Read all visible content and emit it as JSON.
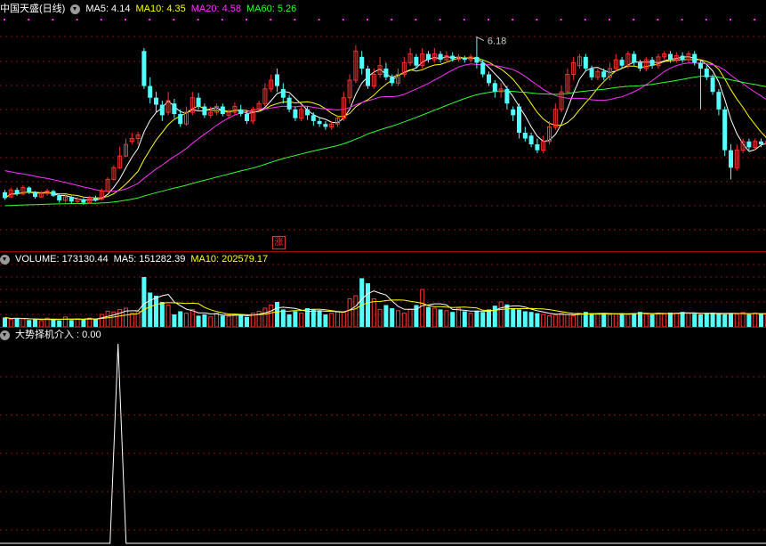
{
  "price_panel": {
    "stock_name": "中国天盛(日线)",
    "ma5": "MA5: 4.14",
    "ma10": "MA10: 4.35",
    "ma20": "MA20: 4.58",
    "ma60": "MA60: 5.26",
    "high_marker": "6.18",
    "limit_up_marker": "涨"
  },
  "volume_panel": {
    "volume": "VOLUME: 173130.44",
    "ma5": "MA5: 151282.39",
    "ma10": "MA10: 202579.17"
  },
  "indicator_panel": {
    "label": "大势择机介入 : 0.00"
  },
  "colors": {
    "up": "#ff3232",
    "down": "#54ffff",
    "ma5": "#ffffff",
    "ma10": "#ffff00",
    "ma20": "#ff32ff",
    "ma60": "#32ff32",
    "grid": "#8a1010",
    "dots": "#ff32ff"
  },
  "chart_data": [
    {
      "type": "candlestick",
      "title": "中国天盛(日线)",
      "ylim": [
        2.6,
        6.6
      ],
      "highest_label": 6.18,
      "moving_averages": {
        "MA5": 4.14,
        "MA10": 4.35,
        "MA20": 4.58,
        "MA60": 5.26
      },
      "candles": [
        {
          "o": 3.58,
          "c": 3.48,
          "h": 3.62,
          "l": 3.45
        },
        {
          "o": 3.5,
          "c": 3.62,
          "h": 3.66,
          "l": 3.48
        },
        {
          "o": 3.62,
          "c": 3.55,
          "h": 3.66,
          "l": 3.52
        },
        {
          "o": 3.55,
          "c": 3.66,
          "h": 3.7,
          "l": 3.53
        },
        {
          "o": 3.66,
          "c": 3.58,
          "h": 3.68,
          "l": 3.55
        },
        {
          "o": 3.58,
          "c": 3.5,
          "h": 3.6,
          "l": 3.47
        },
        {
          "o": 3.5,
          "c": 3.56,
          "h": 3.6,
          "l": 3.48
        },
        {
          "o": 3.56,
          "c": 3.6,
          "h": 3.64,
          "l": 3.52
        },
        {
          "o": 3.6,
          "c": 3.52,
          "h": 3.62,
          "l": 3.5
        },
        {
          "o": 3.52,
          "c": 3.44,
          "h": 3.56,
          "l": 3.4
        },
        {
          "o": 3.44,
          "c": 3.5,
          "h": 3.54,
          "l": 3.4
        },
        {
          "o": 3.5,
          "c": 3.42,
          "h": 3.52,
          "l": 3.38
        },
        {
          "o": 3.42,
          "c": 3.46,
          "h": 3.5,
          "l": 3.38
        },
        {
          "o": 3.46,
          "c": 3.4,
          "h": 3.48,
          "l": 3.36
        },
        {
          "o": 3.4,
          "c": 3.48,
          "h": 3.52,
          "l": 3.38
        },
        {
          "o": 3.48,
          "c": 3.44,
          "h": 3.52,
          "l": 3.42
        },
        {
          "o": 3.46,
          "c": 3.6,
          "h": 3.64,
          "l": 3.44
        },
        {
          "o": 3.6,
          "c": 3.8,
          "h": 3.84,
          "l": 3.58
        },
        {
          "o": 3.8,
          "c": 4.0,
          "h": 4.04,
          "l": 3.78
        },
        {
          "o": 4.0,
          "c": 4.2,
          "h": 4.36,
          "l": 3.98
        },
        {
          "o": 4.2,
          "c": 4.4,
          "h": 4.5,
          "l": 4.18
        },
        {
          "o": 4.45,
          "c": 4.5,
          "h": 4.6,
          "l": 4.4
        },
        {
          "o": 4.5,
          "c": 4.56,
          "h": 4.62,
          "l": 4.4
        },
        {
          "o": 6.0,
          "c": 5.4,
          "h": 6.05,
          "l": 5.35
        },
        {
          "o": 5.4,
          "c": 5.2,
          "h": 5.55,
          "l": 5.1
        },
        {
          "o": 5.2,
          "c": 5.08,
          "h": 5.3,
          "l": 4.95
        },
        {
          "o": 5.08,
          "c": 4.9,
          "h": 5.15,
          "l": 4.8
        },
        {
          "o": 4.95,
          "c": 5.15,
          "h": 5.3,
          "l": 4.9
        },
        {
          "o": 5.1,
          "c": 4.92,
          "h": 5.18,
          "l": 4.85
        },
        {
          "o": 4.92,
          "c": 4.75,
          "h": 5.0,
          "l": 4.7
        },
        {
          "o": 4.75,
          "c": 4.95,
          "h": 5.05,
          "l": 4.72
        },
        {
          "o": 4.95,
          "c": 5.2,
          "h": 5.3,
          "l": 4.9
        },
        {
          "o": 5.2,
          "c": 5.05,
          "h": 5.28,
          "l": 5.0
        },
        {
          "o": 5.05,
          "c": 4.9,
          "h": 5.1,
          "l": 4.85
        },
        {
          "o": 4.9,
          "c": 4.95,
          "h": 5.05,
          "l": 4.85
        },
        {
          "o": 4.95,
          "c": 5.05,
          "h": 5.1,
          "l": 4.9
        },
        {
          "o": 5.05,
          "c": 4.92,
          "h": 5.1,
          "l": 4.88
        },
        {
          "o": 4.9,
          "c": 4.95,
          "h": 5.0,
          "l": 4.85
        },
        {
          "o": 4.95,
          "c": 5.05,
          "h": 5.12,
          "l": 4.9
        },
        {
          "o": 5.0,
          "c": 4.92,
          "h": 5.08,
          "l": 4.88
        },
        {
          "o": 4.92,
          "c": 4.8,
          "h": 4.98,
          "l": 4.75
        },
        {
          "o": 4.8,
          "c": 5.0,
          "h": 5.05,
          "l": 4.75
        },
        {
          "o": 5.0,
          "c": 5.1,
          "h": 5.15,
          "l": 4.95
        },
        {
          "o": 5.1,
          "c": 5.35,
          "h": 5.45,
          "l": 5.05
        },
        {
          "o": 5.35,
          "c": 5.5,
          "h": 5.6,
          "l": 5.3
        },
        {
          "o": 5.6,
          "c": 5.4,
          "h": 5.7,
          "l": 5.3
        },
        {
          "o": 5.35,
          "c": 5.2,
          "h": 5.45,
          "l": 5.1
        },
        {
          "o": 5.2,
          "c": 5.0,
          "h": 5.25,
          "l": 4.95
        },
        {
          "o": 5.0,
          "c": 4.85,
          "h": 5.05,
          "l": 4.8
        },
        {
          "o": 4.85,
          "c": 5.0,
          "h": 5.05,
          "l": 4.8
        },
        {
          "o": 5.0,
          "c": 4.9,
          "h": 5.05,
          "l": 4.82
        },
        {
          "o": 4.9,
          "c": 4.8,
          "h": 4.95,
          "l": 4.72
        },
        {
          "o": 4.8,
          "c": 4.75,
          "h": 4.85,
          "l": 4.7
        },
        {
          "o": 4.75,
          "c": 4.7,
          "h": 4.8,
          "l": 4.65
        },
        {
          "o": 4.7,
          "c": 4.75,
          "h": 4.8,
          "l": 4.65
        },
        {
          "o": 4.75,
          "c": 4.85,
          "h": 4.9,
          "l": 4.7
        },
        {
          "o": 4.85,
          "c": 5.2,
          "h": 5.3,
          "l": 4.8
        },
        {
          "o": 5.2,
          "c": 5.5,
          "h": 5.6,
          "l": 5.1
        },
        {
          "o": 5.5,
          "c": 6.0,
          "h": 6.1,
          "l": 5.45
        },
        {
          "o": 5.9,
          "c": 5.7,
          "h": 6.0,
          "l": 5.6
        },
        {
          "o": 5.7,
          "c": 5.4,
          "h": 5.75,
          "l": 5.35
        },
        {
          "o": 5.4,
          "c": 5.6,
          "h": 5.7,
          "l": 5.35
        },
        {
          "o": 5.6,
          "c": 5.75,
          "h": 5.9,
          "l": 5.55
        },
        {
          "o": 5.7,
          "c": 5.55,
          "h": 5.8,
          "l": 5.5
        },
        {
          "o": 5.55,
          "c": 5.45,
          "h": 5.6,
          "l": 5.4
        },
        {
          "o": 5.45,
          "c": 5.6,
          "h": 5.7,
          "l": 5.4
        },
        {
          "o": 5.6,
          "c": 5.8,
          "h": 5.9,
          "l": 5.55
        },
        {
          "o": 5.8,
          "c": 5.95,
          "h": 6.05,
          "l": 5.75
        },
        {
          "o": 5.9,
          "c": 5.75,
          "h": 5.95,
          "l": 5.7
        },
        {
          "o": 5.75,
          "c": 5.95,
          "h": 6.05,
          "l": 5.7
        },
        {
          "o": 5.95,
          "c": 5.85,
          "h": 6.0,
          "l": 5.8
        },
        {
          "o": 5.85,
          "c": 5.95,
          "h": 6.05,
          "l": 5.8
        },
        {
          "o": 5.95,
          "c": 5.85,
          "h": 6.0,
          "l": 5.8
        },
        {
          "o": 5.85,
          "c": 5.92,
          "h": 6.0,
          "l": 5.8
        },
        {
          "o": 5.92,
          "c": 5.86,
          "h": 5.98,
          "l": 5.82
        },
        {
          "o": 5.86,
          "c": 5.9,
          "h": 5.95,
          "l": 5.82
        },
        {
          "o": 5.88,
          "c": 5.85,
          "h": 5.92,
          "l": 5.8
        },
        {
          "o": 5.85,
          "c": 5.9,
          "h": 5.95,
          "l": 5.8
        },
        {
          "o": 5.9,
          "c": 5.8,
          "h": 6.18,
          "l": 5.7
        },
        {
          "o": 5.8,
          "c": 5.6,
          "h": 5.85,
          "l": 5.55
        },
        {
          "o": 5.6,
          "c": 5.45,
          "h": 5.65,
          "l": 5.4
        },
        {
          "o": 5.45,
          "c": 5.3,
          "h": 5.5,
          "l": 5.2
        },
        {
          "o": 5.3,
          "c": 5.35,
          "h": 5.45,
          "l": 5.2
        },
        {
          "o": 5.35,
          "c": 5.1,
          "h": 5.4,
          "l": 5.0
        },
        {
          "o": 5.0,
          "c": 4.9,
          "h": 5.05,
          "l": 4.8
        },
        {
          "o": 5.05,
          "c": 4.6,
          "h": 5.1,
          "l": 4.5
        },
        {
          "o": 4.6,
          "c": 4.5,
          "h": 4.7,
          "l": 4.45
        },
        {
          "o": 4.55,
          "c": 4.4,
          "h": 4.6,
          "l": 4.35
        },
        {
          "o": 4.4,
          "c": 4.3,
          "h": 4.5,
          "l": 4.25
        },
        {
          "o": 4.3,
          "c": 4.45,
          "h": 4.55,
          "l": 4.25
        },
        {
          "o": 4.45,
          "c": 4.7,
          "h": 4.8,
          "l": 4.4
        },
        {
          "o": 4.7,
          "c": 5.0,
          "h": 5.1,
          "l": 4.65
        },
        {
          "o": 5.0,
          "c": 5.3,
          "h": 5.4,
          "l": 4.95
        },
        {
          "o": 5.3,
          "c": 5.6,
          "h": 5.7,
          "l": 5.25
        },
        {
          "o": 5.6,
          "c": 5.8,
          "h": 5.9,
          "l": 5.5
        },
        {
          "o": 5.75,
          "c": 5.9,
          "h": 5.95,
          "l": 5.7
        },
        {
          "o": 5.9,
          "c": 5.7,
          "h": 5.95,
          "l": 5.65
        },
        {
          "o": 5.7,
          "c": 5.55,
          "h": 5.75,
          "l": 5.5
        },
        {
          "o": 5.55,
          "c": 5.65,
          "h": 5.7,
          "l": 5.5
        },
        {
          "o": 5.65,
          "c": 5.55,
          "h": 5.7,
          "l": 5.5
        },
        {
          "o": 5.55,
          "c": 5.7,
          "h": 5.8,
          "l": 5.5
        },
        {
          "o": 5.7,
          "c": 5.85,
          "h": 5.95,
          "l": 5.65
        },
        {
          "o": 5.85,
          "c": 5.75,
          "h": 5.9,
          "l": 5.7
        },
        {
          "o": 5.75,
          "c": 5.95,
          "h": 6.0,
          "l": 5.7
        },
        {
          "o": 5.95,
          "c": 5.8,
          "h": 6.0,
          "l": 5.75
        },
        {
          "o": 5.8,
          "c": 5.7,
          "h": 5.85,
          "l": 5.65
        },
        {
          "o": 5.7,
          "c": 5.85,
          "h": 5.9,
          "l": 5.65
        },
        {
          "o": 5.85,
          "c": 5.75,
          "h": 5.9,
          "l": 5.7
        },
        {
          "o": 5.75,
          "c": 5.9,
          "h": 5.95,
          "l": 5.7
        },
        {
          "o": 5.9,
          "c": 5.95,
          "h": 6.0,
          "l": 5.85
        },
        {
          "o": 5.95,
          "c": 5.85,
          "h": 6.0,
          "l": 5.8
        },
        {
          "o": 5.85,
          "c": 5.92,
          "h": 5.98,
          "l": 5.8
        },
        {
          "o": 5.92,
          "c": 5.85,
          "h": 5.98,
          "l": 5.8
        },
        {
          "o": 5.85,
          "c": 5.95,
          "h": 6.0,
          "l": 5.8
        },
        {
          "o": 5.95,
          "c": 5.8,
          "h": 6.0,
          "l": 5.75
        },
        {
          "o": 5.8,
          "c": 5.7,
          "h": 5.85,
          "l": 5.0
        },
        {
          "o": 5.7,
          "c": 5.55,
          "h": 5.75,
          "l": 5.5
        },
        {
          "o": 5.55,
          "c": 5.3,
          "h": 5.6,
          "l": 5.25
        },
        {
          "o": 5.3,
          "c": 5.0,
          "h": 5.35,
          "l": 4.9
        },
        {
          "o": 5.0,
          "c": 4.3,
          "h": 5.05,
          "l": 4.2
        },
        {
          "o": 4.3,
          "c": 4.0,
          "h": 4.4,
          "l": 3.8
        },
        {
          "o": 4.0,
          "c": 4.3,
          "h": 4.4,
          "l": 3.95
        },
        {
          "o": 4.3,
          "c": 4.45,
          "h": 4.5,
          "l": 4.25
        },
        {
          "o": 4.45,
          "c": 4.35,
          "h": 4.5,
          "l": 4.3
        },
        {
          "o": 4.35,
          "c": 4.45,
          "h": 4.5,
          "l": 4.3
        },
        {
          "o": 4.45,
          "c": 4.4,
          "h": 4.5,
          "l": 4.35
        },
        {
          "o": 4.4,
          "c": 4.45,
          "h": 4.5,
          "l": 4.35
        },
        {
          "o": 4.45,
          "c": 4.3,
          "h": 4.5,
          "l": 4.25
        }
      ]
    },
    {
      "type": "bar",
      "title": "VOLUME",
      "moving_averages": {
        "MA5": 151282.39,
        "MA10": 202579.17
      },
      "values": [
        0.15,
        0.12,
        0.14,
        0.13,
        0.11,
        0.12,
        0.1,
        0.14,
        0.12,
        0.1,
        0.16,
        0.11,
        0.13,
        0.12,
        0.14,
        0.13,
        0.2,
        0.25,
        0.24,
        0.28,
        0.3,
        0.22,
        0.25,
        0.8,
        0.55,
        0.5,
        0.4,
        0.35,
        0.2,
        0.25,
        0.22,
        0.28,
        0.18,
        0.2,
        0.16,
        0.22,
        0.18,
        0.17,
        0.2,
        0.19,
        0.16,
        0.22,
        0.25,
        0.3,
        0.35,
        0.4,
        0.28,
        0.2,
        0.25,
        0.22,
        0.3,
        0.28,
        0.26,
        0.2,
        0.22,
        0.25,
        0.24,
        0.45,
        0.5,
        0.78,
        0.7,
        0.45,
        0.28,
        0.35,
        0.3,
        0.26,
        0.22,
        0.28,
        0.35,
        0.6,
        0.32,
        0.3,
        0.28,
        0.26,
        0.24,
        0.3,
        0.25,
        0.22,
        0.26,
        0.24,
        0.28,
        0.34,
        0.4,
        0.36,
        0.3,
        0.28,
        0.25,
        0.24,
        0.22,
        0.2,
        0.18,
        0.19,
        0.22,
        0.2,
        0.18,
        0.22,
        0.24,
        0.22,
        0.21,
        0.2,
        0.2,
        0.21,
        0.22,
        0.2,
        0.22,
        0.24,
        0.21,
        0.2,
        0.22,
        0.21,
        0.23,
        0.22,
        0.24,
        0.22,
        0.21,
        0.2,
        0.22,
        0.23,
        0.21,
        0.2,
        0.22,
        0.21,
        0.23,
        0.2,
        0.22,
        0.21,
        0.2,
        0.19,
        0.22,
        0.2
      ]
    },
    {
      "type": "line",
      "title": "大势择机介入",
      "value": 0.0,
      "spike_index": 19,
      "spike_value": 1
    }
  ]
}
